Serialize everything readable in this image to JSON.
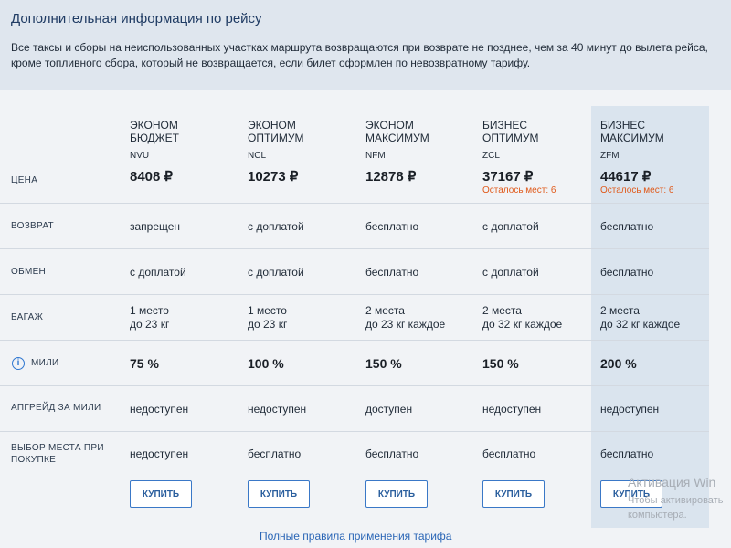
{
  "header": {
    "title": "Дополнительная информация по рейсу",
    "note": "Все таксы и сборы на неиспользованных участках маршрута возвращаются при возврате не позднее, чем за 40 минут до вылета рейса, кроме топливного сбора, который не возвращается, если билет оформлен по невозвратному тарифу."
  },
  "labels": {
    "price": "ЦЕНА",
    "refund": "ВОЗВРАТ",
    "exchange": "ОБМЕН",
    "baggage": "БАГАЖ",
    "miles": "МИЛИ",
    "upgrade": "АПГРЕЙД ЗА МИЛИ",
    "seat_line1": "ВЫБОР МЕСТА ПРИ",
    "seat_line2": "ПОКУПКЕ"
  },
  "fares": [
    {
      "name1": "ЭКОНОМ",
      "name2": "БЮДЖЕТ",
      "code": "NVU",
      "price": "8408 ₽",
      "seats": "",
      "refund": "запрещен",
      "exchange": "с доплатой",
      "baggage1": "1 место",
      "baggage2": "до 23 кг",
      "miles": "75 %",
      "upgrade": "недоступен",
      "seat": "недоступен",
      "buy": "КУПИТЬ"
    },
    {
      "name1": "ЭКОНОМ",
      "name2": "ОПТИМУМ",
      "code": "NCL",
      "price": "10273 ₽",
      "seats": "",
      "refund": "с доплатой",
      "exchange": "с доплатой",
      "baggage1": "1 место",
      "baggage2": "до 23 кг",
      "miles": "100 %",
      "upgrade": "недоступен",
      "seat": "бесплатно",
      "buy": "КУПИТЬ"
    },
    {
      "name1": "ЭКОНОМ",
      "name2": "МАКСИМУМ",
      "code": "NFM",
      "price": "12878 ₽",
      "seats": "",
      "refund": "бесплатно",
      "exchange": "бесплатно",
      "baggage1": "2 места",
      "baggage2": "до 23 кг каждое",
      "miles": "150 %",
      "upgrade": "доступен",
      "seat": "бесплатно",
      "buy": "КУПИТЬ"
    },
    {
      "name1": "БИЗНЕС",
      "name2": "ОПТИМУМ",
      "code": "ZCL",
      "price": "37167 ₽",
      "seats": "Осталось мест: 6",
      "refund": "с доплатой",
      "exchange": "с доплатой",
      "baggage1": "2 места",
      "baggage2": "до 32 кг каждое",
      "miles": "150 %",
      "upgrade": "недоступен",
      "seat": "бесплатно",
      "buy": "КУПИТЬ"
    },
    {
      "name1": "БИЗНЕС",
      "name2": "МАКСИМУМ",
      "code": "ZFM",
      "price": "44617 ₽",
      "seats": "Осталось мест: 6",
      "refund": "бесплатно",
      "exchange": "бесплатно",
      "baggage1": "2 места",
      "baggage2": "до 32 кг каждое",
      "miles": "200 %",
      "upgrade": "недоступен",
      "seat": "бесплатно",
      "buy": "КУПИТЬ"
    }
  ],
  "footer": {
    "rules_link": "Полные правила применения тарифа"
  },
  "watermark": {
    "title": "Активация Win",
    "line1": "Чтобы активировать",
    "line2": "компьютера."
  },
  "icons": {
    "miles_info": "info-icon"
  },
  "colors": {
    "seats_warning": "#e05a1b",
    "accent": "#3a78c7",
    "highlight": "#dae4ee"
  }
}
